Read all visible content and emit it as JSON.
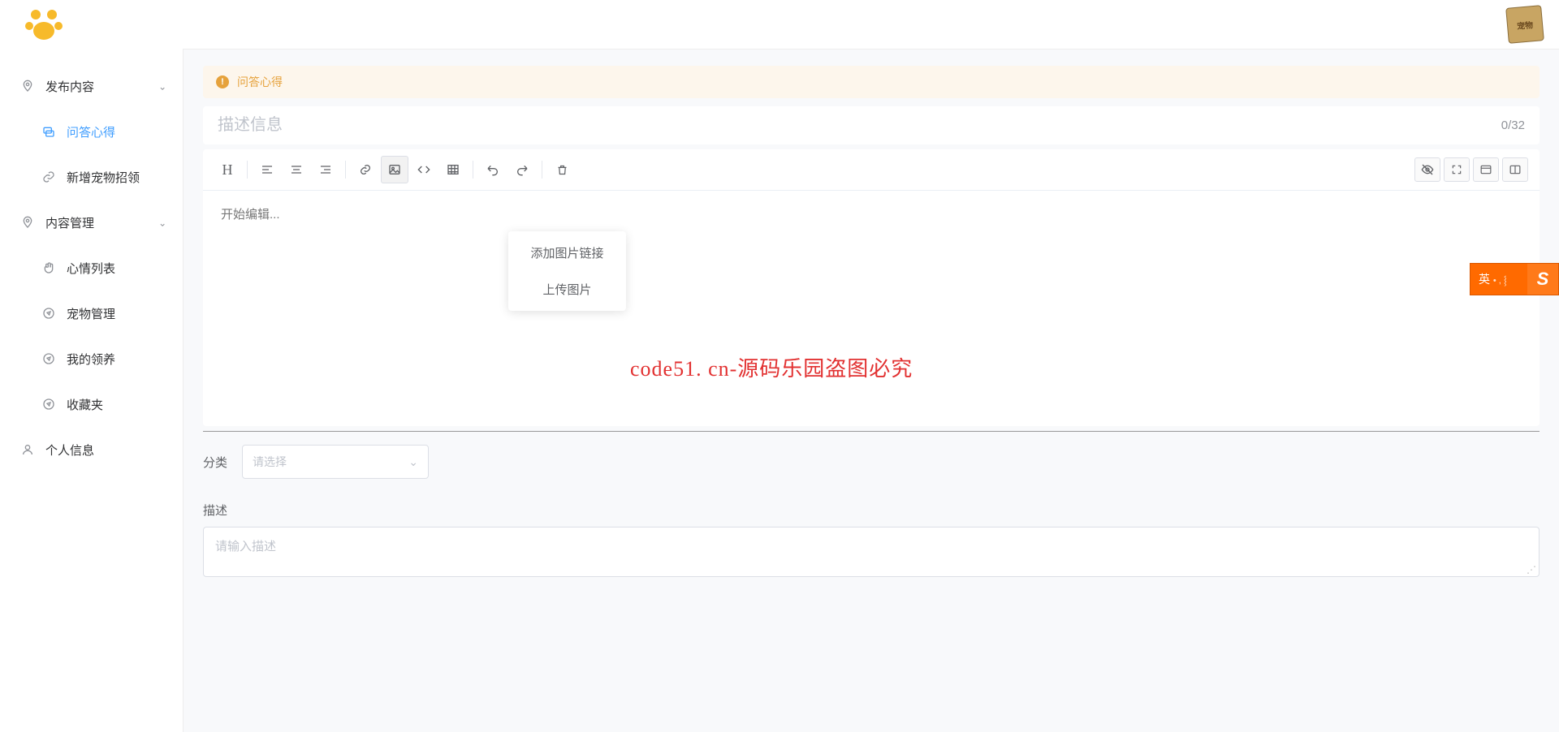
{
  "header": {
    "avatar_text": "宠物"
  },
  "sidebar": {
    "group1": {
      "label": "发布内容",
      "items": [
        {
          "label": "问答心得"
        },
        {
          "label": "新增宠物招领"
        }
      ]
    },
    "group2": {
      "label": "内容管理",
      "items": [
        {
          "label": "心情列表"
        },
        {
          "label": "宠物管理"
        },
        {
          "label": "我的领养"
        },
        {
          "label": "收藏夹"
        }
      ]
    },
    "item3": {
      "label": "个人信息"
    }
  },
  "banner": {
    "label": "问答心得"
  },
  "title": {
    "placeholder": "描述信息",
    "counter": "0/32"
  },
  "editor": {
    "placeholder": "开始编辑..."
  },
  "image_menu": {
    "link": "添加图片链接",
    "upload": "上传图片"
  },
  "category": {
    "label": "分类",
    "placeholder": "请选择"
  },
  "desc": {
    "label": "描述",
    "placeholder": "请输入描述"
  },
  "watermark": "code51. cn-源码乐园盗图必究",
  "ime": {
    "lang": "英"
  }
}
